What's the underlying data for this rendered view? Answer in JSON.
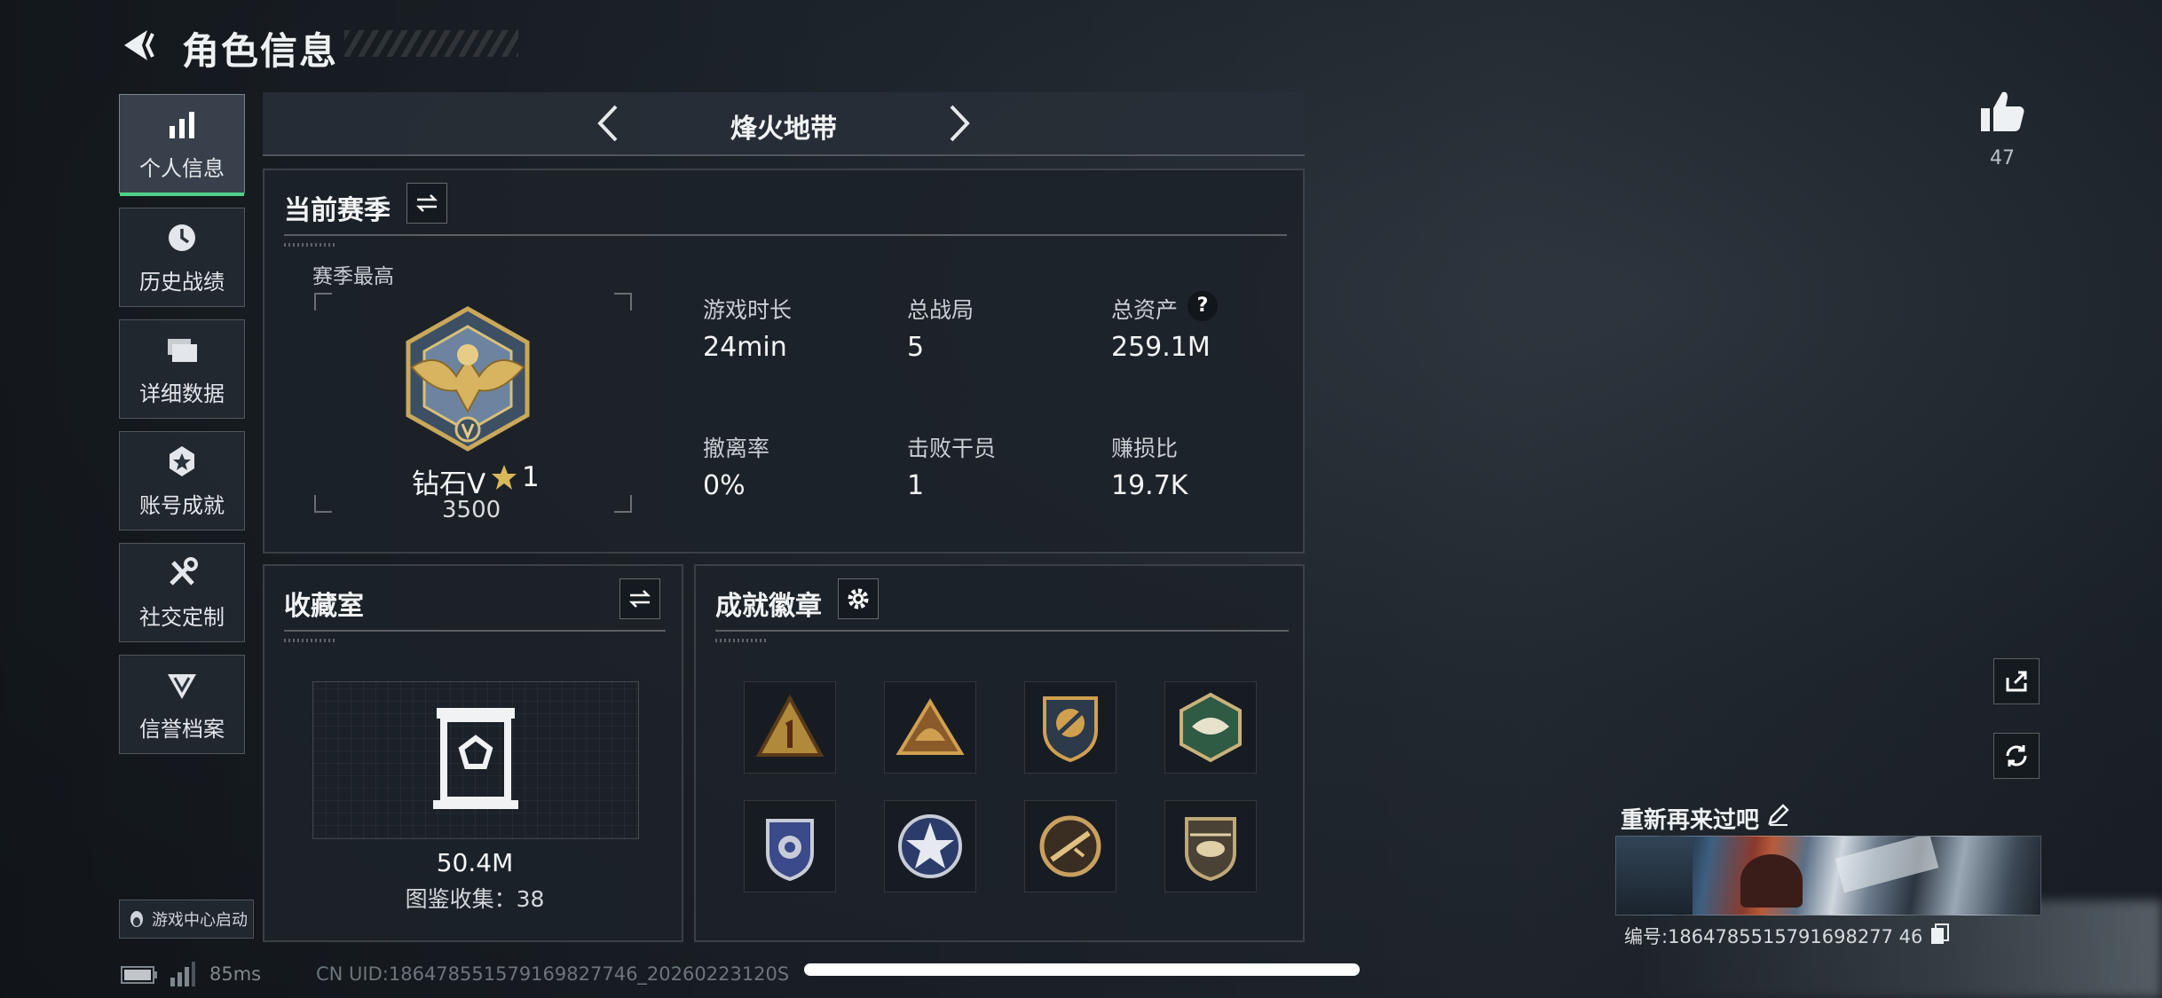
{
  "header": {
    "title": "角色信息"
  },
  "sidebar": {
    "items": [
      {
        "label": "个人信息",
        "icon": "bar-chart-icon",
        "active": true
      },
      {
        "label": "历史战绩",
        "icon": "history-icon"
      },
      {
        "label": "详细数据",
        "icon": "folder-icon"
      },
      {
        "label": "账号成就",
        "icon": "medal-icon"
      },
      {
        "label": "社交定制",
        "icon": "tools-icon"
      },
      {
        "label": "信誉档案",
        "icon": "shield-badge-icon"
      }
    ],
    "game_center": "游戏中心启动"
  },
  "mode_bar": {
    "title": "烽火地带"
  },
  "season": {
    "title": "当前赛季",
    "best_label": "赛季最高",
    "rank_name": "钻石V",
    "rank_stars": "1",
    "rank_score": "3500",
    "stats": [
      {
        "label": "游戏时长",
        "value": "24min"
      },
      {
        "label": "总战局",
        "value": "5"
      },
      {
        "label": "总资产",
        "value": "259.1M",
        "has_help": true,
        "help": "?"
      },
      {
        "label": "撤离率",
        "value": "0%"
      },
      {
        "label": "击败干员",
        "value": "1"
      },
      {
        "label": "赚损比",
        "value": "19.7K"
      }
    ]
  },
  "collection": {
    "title": "收藏室",
    "value": "50.4M",
    "collect_text": "图鉴收集：38"
  },
  "achievements": {
    "title": "成就徽章",
    "badges": [
      "triangle-1-badge",
      "triangle-helmet-badge",
      "shield-crest-badge",
      "hexagon-green-badge",
      "police-badge",
      "star-badge",
      "circle-rifle-badge",
      "helicopter-badge"
    ]
  },
  "right_panel": {
    "likes": "47",
    "profile_name": "重新再来过吧",
    "uid_text": "编号:1864785515791698277 46"
  },
  "status_bar": {
    "ping": "85ms",
    "cn_uid": "CN UID:186478551579169827746_20260223120S"
  },
  "colors": {
    "accent_green": "#4fd18a",
    "panel_bg": "#1c2229",
    "text_primary": "#f0f2f4"
  }
}
